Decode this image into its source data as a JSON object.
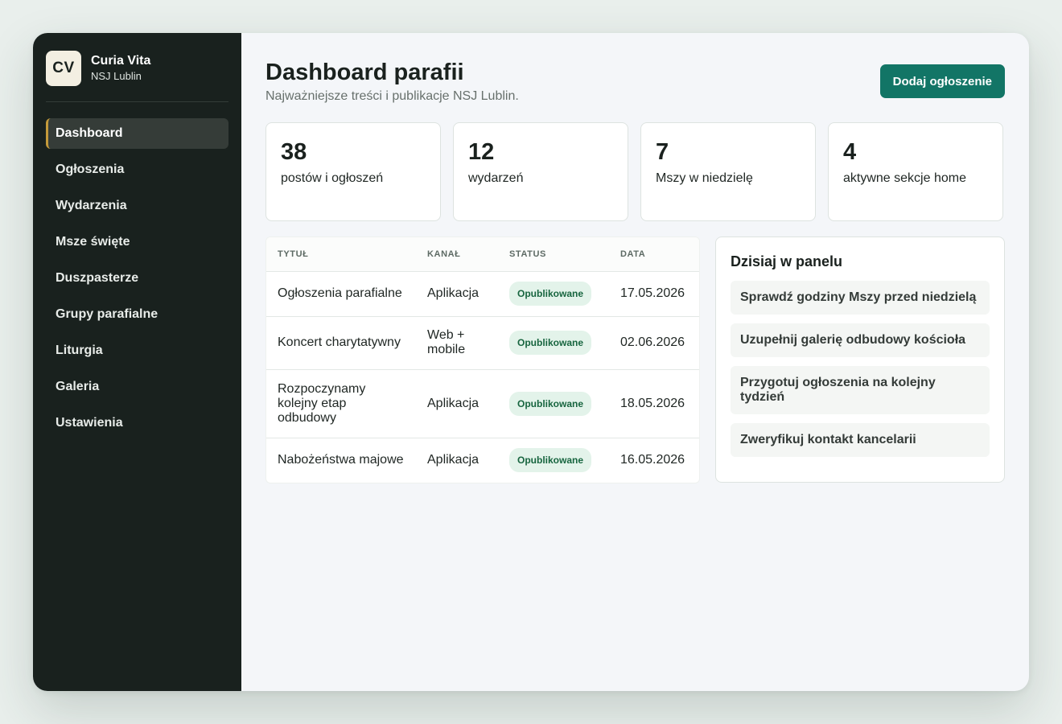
{
  "brand": {
    "logo": "CV",
    "name": "Curia Vita",
    "subtitle": "NSJ Lublin"
  },
  "sidebar": {
    "items": [
      {
        "label": "Dashboard",
        "active": true
      },
      {
        "label": "Ogłoszenia"
      },
      {
        "label": "Wydarzenia"
      },
      {
        "label": "Msze święte"
      },
      {
        "label": "Duszpasterze"
      },
      {
        "label": "Grupy parafialne"
      },
      {
        "label": "Liturgia"
      },
      {
        "label": "Galeria"
      },
      {
        "label": "Ustawienia"
      }
    ]
  },
  "header": {
    "title": "Dashboard parafii",
    "subtitle": "Najważniejsze treści i publikacje NSJ Lublin.",
    "add_button": "Dodaj ogłoszenie"
  },
  "stats": [
    {
      "value": "38",
      "label": "postów i ogłoszeń"
    },
    {
      "value": "12",
      "label": "wydarzeń"
    },
    {
      "value": "7",
      "label": "Mszy w niedzielę"
    },
    {
      "value": "4",
      "label": "aktywne sekcje home"
    }
  ],
  "table": {
    "headers": [
      "TYTUŁ",
      "KANAŁ",
      "STATUS",
      "DATA"
    ],
    "rows": [
      {
        "title": "Ogłoszenia parafialne",
        "channel": "Aplikacja",
        "status": "Opublikowane",
        "date": "17.05.2026"
      },
      {
        "title": "Koncert charytatywny",
        "channel": "Web + mobile",
        "status": "Opublikowane",
        "date": "02.06.2026"
      },
      {
        "title": "Rozpoczynamy kolejny etap odbudowy",
        "channel": "Aplikacja",
        "status": "Opublikowane",
        "date": "18.05.2026"
      },
      {
        "title": "Nabożeństwa majowe",
        "channel": "Aplikacja",
        "status": "Opublikowane",
        "date": "16.05.2026"
      }
    ]
  },
  "panel": {
    "title": "Dzisiaj w panelu",
    "tasks": [
      "Sprawdź godziny Mszy przed niedzielą",
      "Uzupełnij galerię odbudowy kościoła",
      "Przygotuj ogłoszenia na kolejny tydzień",
      "Zweryfikuj kontakt kancelarii"
    ]
  },
  "colors": {
    "sidebar_bg": "#19211e",
    "accent": "#127566",
    "active_marker": "#c49a3a",
    "badge_bg": "#e3f3ea",
    "badge_text": "#17653f"
  }
}
